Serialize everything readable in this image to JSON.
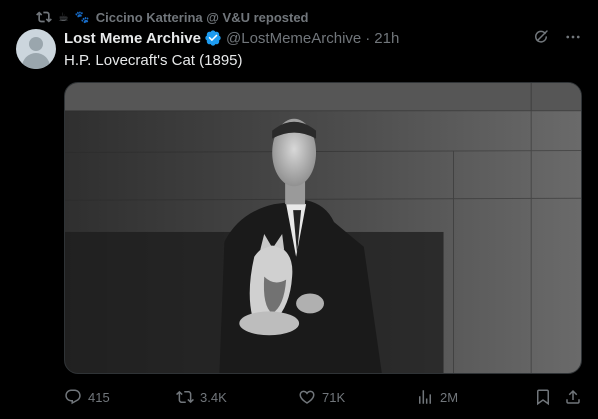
{
  "repost": {
    "reposter_label": "Ciccino Katterina @ V&U reposted",
    "emoji_1": "☕",
    "emoji_2": "🐾"
  },
  "tweet": {
    "display_name": "Lost Meme Archive",
    "handle": "@LostMemeArchive",
    "separator": "·",
    "time": "21h",
    "text": "H.P. Lovecraft's Cat (1895)",
    "verified": true
  },
  "actions": {
    "replies": "415",
    "reposts": "3.4K",
    "likes": "71K",
    "views": "2M"
  },
  "colors": {
    "background": "#000000",
    "text_primary": "#e7e9ea",
    "text_secondary": "#71767b",
    "verified_blue": "#1d9bf0"
  },
  "icons": [
    "repost-icon",
    "verified-icon",
    "grok-icon",
    "more-icon",
    "reply-icon",
    "repost-icon",
    "like-icon",
    "views-icon",
    "bookmark-icon",
    "share-icon"
  ]
}
